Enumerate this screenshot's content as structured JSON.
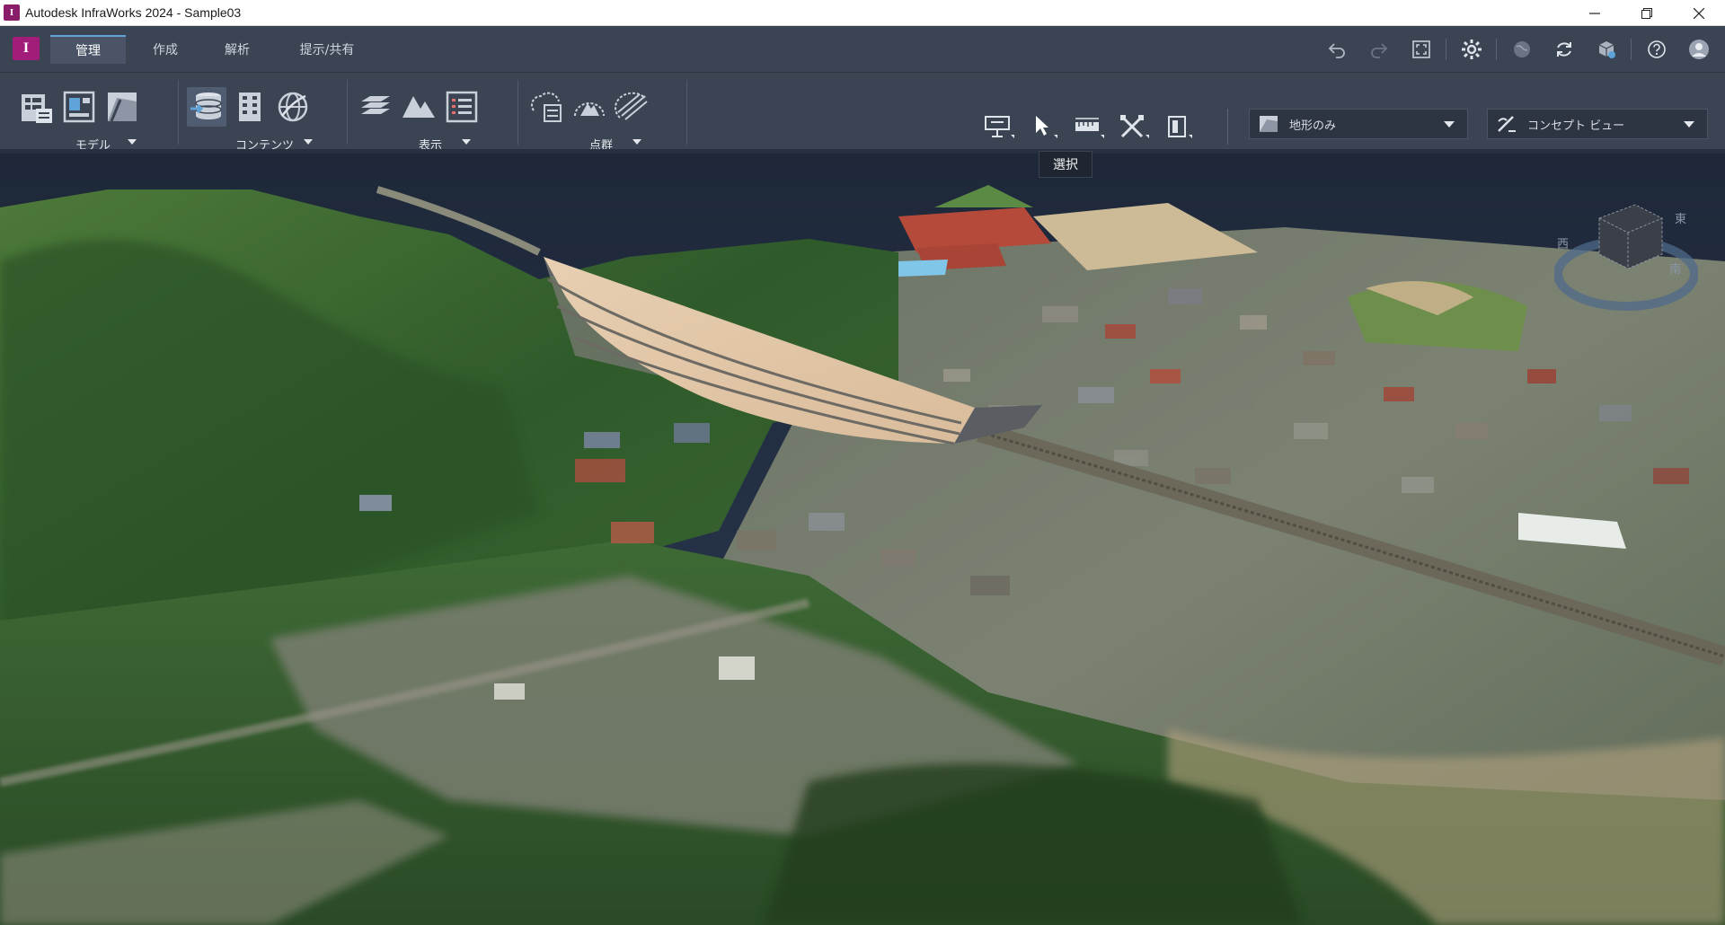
{
  "window": {
    "title": "Autodesk InfraWorks 2024 - Sample03",
    "app_logo_letter": "I",
    "controls": [
      "minimize",
      "restore",
      "close"
    ]
  },
  "tabs": [
    {
      "label": "管理",
      "active": true
    },
    {
      "label": "作成",
      "active": false
    },
    {
      "label": "解析",
      "active": false
    },
    {
      "label": "提示/共有",
      "active": false
    }
  ],
  "quick_access": {
    "icons": [
      "undo-icon",
      "redo-icon",
      "fit-view-icon",
      "settings-icon",
      "globe-icon",
      "sync-icon",
      "model-share-icon",
      "help-icon",
      "user-avatar-icon"
    ]
  },
  "ribbon": {
    "groups": [
      {
        "label": "モデル",
        "icons": [
          "model-properties-icon",
          "model-view-icon",
          "model-map-icon"
        ]
      },
      {
        "label": "コンテンツ",
        "icons": [
          "data-sources-icon",
          "building-grid-icon",
          "globe-network-icon"
        ]
      },
      {
        "label": "表示",
        "icons": [
          "layers-icon",
          "terrain-icon",
          "list-view-icon"
        ]
      },
      {
        "label": "点群",
        "icons": [
          "point-cloud-list-icon",
          "point-cloud-terrain-icon",
          "point-cloud-slice-icon"
        ]
      }
    ],
    "tools": [
      "presentation-tool-icon",
      "select-tool-icon",
      "measure-tool-icon",
      "cut-tool-icon",
      "clip-tool-icon"
    ],
    "tooltip": "選択",
    "dropdowns": [
      {
        "icon": "terrain-style-icon",
        "value": "地形のみ"
      },
      {
        "icon": "visual-style-icon",
        "value": "コンセプト ビュー"
      }
    ]
  },
  "nav_cube": {
    "directions": {
      "west": "西",
      "south": "南",
      "east": "東"
    }
  },
  "colors": {
    "ribbon_bg": "#3b4453",
    "accent": "#5fa3d8",
    "logo": "#a21c7a",
    "sea": "#1f2a3d",
    "terrain_green": "#3c6a32",
    "design_surface": "#e2c6a6"
  }
}
